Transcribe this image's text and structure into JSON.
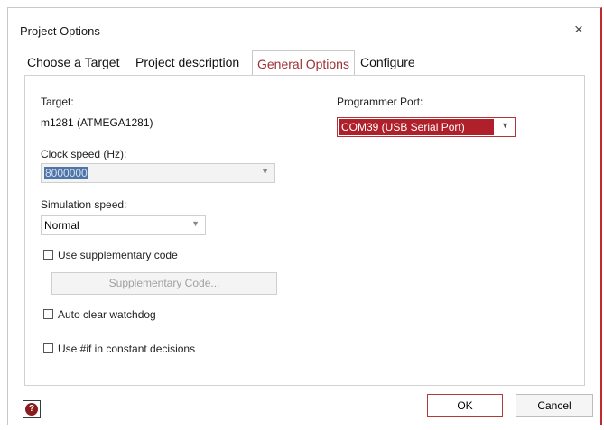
{
  "window": {
    "title": "Project Options",
    "close_glyph": "×"
  },
  "tabs": [
    {
      "label": "Choose a Target",
      "active": false
    },
    {
      "label": "Project description",
      "active": false
    },
    {
      "label": "General Options",
      "active": true
    },
    {
      "label": "Configure",
      "active": false
    }
  ],
  "general": {
    "target_label": "Target:",
    "target_value": "m1281 (ATMEGA1281)",
    "clock_label": "Clock speed (Hz):",
    "clock_value": "8000000",
    "sim_label": "Simulation speed:",
    "sim_value": "Normal",
    "supp_code_label": "Use supplementary code",
    "supp_code_checked": false,
    "supp_button_mnemonic": "S",
    "supp_button_rest": "upplementary Code...",
    "watchdog_label": "Auto clear watchdog",
    "watchdog_checked": false,
    "hashif_label": "Use #if in constant decisions",
    "hashif_checked": false,
    "programmer_label": "Programmer Port:",
    "programmer_value": "COM39 (USB Serial Port)"
  },
  "footer": {
    "ok_label": "OK",
    "cancel_label": "Cancel",
    "help_icon": "help-icon",
    "help_glyph": "?"
  },
  "colors": {
    "accent": "#b0202a",
    "active_tab_text": "#9b3034",
    "selection": "#4f74a8"
  }
}
